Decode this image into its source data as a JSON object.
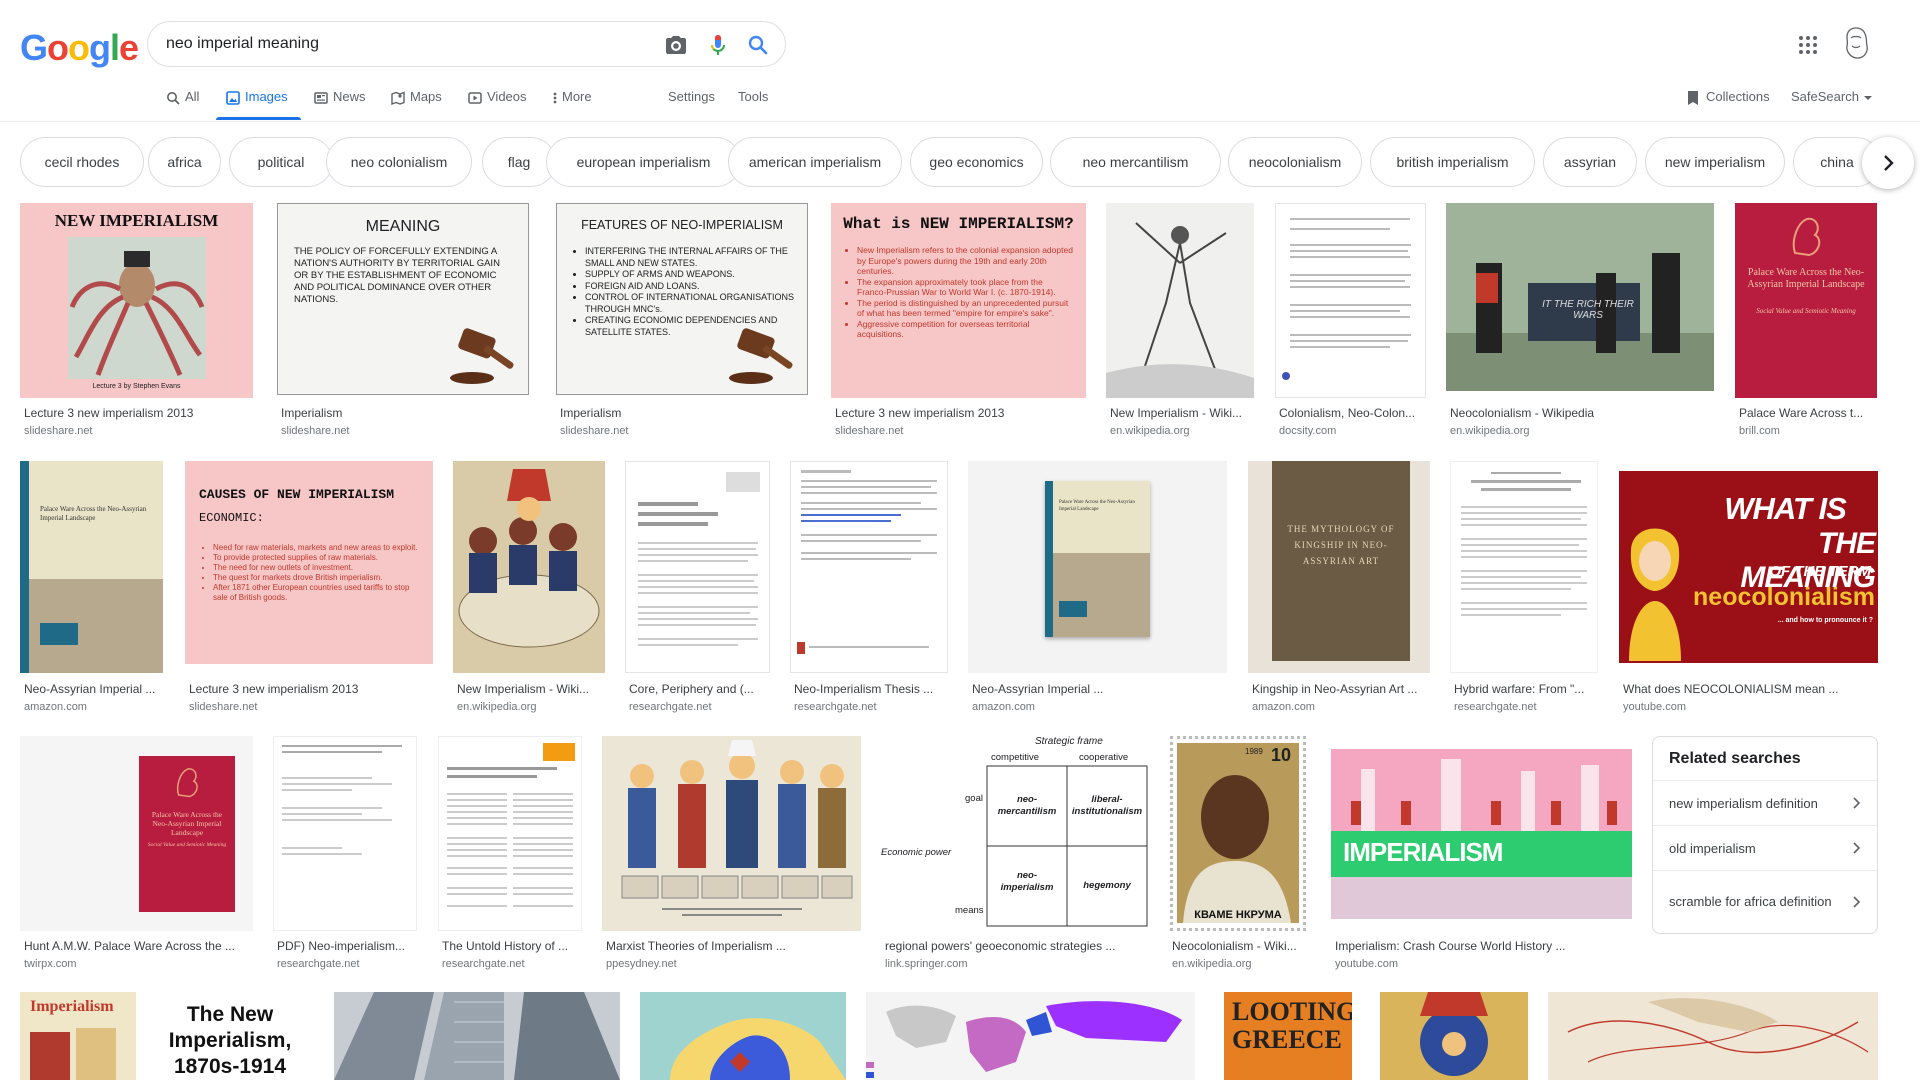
{
  "logo": {
    "letters": [
      "G",
      "o",
      "o",
      "g",
      "l",
      "e"
    ],
    "colors": [
      "#4285F4",
      "#EA4335",
      "#FBBC05",
      "#4285F4",
      "#34A853",
      "#EA4335"
    ]
  },
  "search": {
    "query": "neo imperial meaning"
  },
  "tabs": [
    {
      "label": "All",
      "icon": "search-icon"
    },
    {
      "label": "Images",
      "icon": "image-icon",
      "active": true
    },
    {
      "label": "News",
      "icon": "news-icon"
    },
    {
      "label": "Maps",
      "icon": "map-icon"
    },
    {
      "label": "Videos",
      "icon": "video-icon"
    },
    {
      "label": "More",
      "icon": "more-icon"
    },
    {
      "label": "Settings"
    },
    {
      "label": "Tools"
    }
  ],
  "right_tools": {
    "collections": "Collections",
    "safesearch": "SafeSearch"
  },
  "chips": [
    "cecil rhodes",
    "africa",
    "political",
    "neo colonialism",
    "flag",
    "european imperialism",
    "american imperialism",
    "geo economics",
    "neo mercantilism",
    "neocolonialism",
    "british imperialism",
    "assyrian",
    "new imperialism",
    "china",
    "imperialism"
  ],
  "slides": {
    "s1": {
      "title": "NEW IMPERIALISM",
      "caption": "Lecture 3 by Stephen Evans"
    },
    "s2": {
      "title": "MEANING",
      "body": "THE POLICY OF FORCEFULLY EXTENDING A NATION'S AUTHORITY BY TERRITORIAL GAIN OR BY THE ESTABLISHMENT OF ECONOMIC AND POLITICAL DOMINANCE OVER OTHER NATIONS."
    },
    "s3": {
      "title": "FEATURES OF NEO-IMPERIALISM",
      "items": [
        "INTERFERING THE INTERNAL AFFAIRS OF THE SMALL AND NEW STATES.",
        "SUPPLY OF ARMS AND WEAPONS.",
        "FOREIGN AID AND LOANS.",
        "CONTROL OF INTERNATIONAL ORGANISATIONS THROUGH MNC's.",
        "CREATING ECONOMIC DEPENDENCIES AND SATELLITE STATES."
      ]
    },
    "s4": {
      "title": "What is NEW IMPERIALISM?",
      "items": [
        "New Imperialism refers to the colonial expansion adopted by Europe's powers during the 19th and early 20th centuries.",
        "The expansion approximately took place from the Franco-Prussian War to World War I. (c. 1870-1914).",
        "The period is distinguished by an unprecedented pursuit of what has been termed \"empire for empire's sake\".",
        "Aggressive competition for overseas territorial acquisitions."
      ]
    },
    "s5": {
      "title": "CAUSES OF NEW IMPERIALISM",
      "sub": "ECONOMIC:",
      "items": [
        "Need for raw materials, markets and new areas to exploit.",
        "To provide protected supplies of raw materials.",
        "The need for new outlets of investment.",
        "The quest for markets drove British imperialism.",
        "After 1871 other European countries used tariffs to stop sale of British goods."
      ]
    },
    "book": {
      "title": "Palace Ware Across the Neo-Assyrian Imperial Landscape",
      "subtitle": "Social Value and Semiotic Meaning"
    },
    "kingship": "THE MYTHOLOGY OF KINGSHIP IN NEO-ASSYRIAN ART",
    "video": {
      "l1": "WHAT IS",
      "l2": "THE MEANING",
      "l3": "OF THE TERM",
      "l4": "neocolonialism",
      "l5": "... and how to pronounce it ?"
    },
    "protest": "IT THE RICH THEIR WARS",
    "imperialism": "IMPERIALISM",
    "grid": {
      "frame": "Strategic frame",
      "col1": "competitive",
      "col2": "cooperative",
      "goal": "goal",
      "means": "means",
      "ep": "Economic power",
      "c11": "neo-mercantilism",
      "c12": "liberal-institutionalism",
      "c21": "neo-imperialism",
      "c22": "hegemony"
    },
    "stamp": {
      "value": "10",
      "year": "1989",
      "name": "КВАМЕ НКРУМА"
    },
    "bottom1": {
      "a": "Imperialism",
      "b": "The New Imperialism, 1870s-1914"
    },
    "looting": "LOOTING GREECE"
  },
  "results": [
    {
      "title": "Lecture 3 new imperialism 2013",
      "source": "slideshare.net"
    },
    {
      "title": "Imperialism",
      "source": "slideshare.net"
    },
    {
      "title": "Imperialism",
      "source": "slideshare.net"
    },
    {
      "title": "Lecture 3 new imperialism 2013",
      "source": "slideshare.net"
    },
    {
      "title": "New Imperialism - Wiki...",
      "source": "en.wikipedia.org"
    },
    {
      "title": "Colonialism, Neo-Colon...",
      "source": "docsity.com"
    },
    {
      "title": "Neocolonialism - Wikipedia",
      "source": "en.wikipedia.org"
    },
    {
      "title": "Palace Ware Across t...",
      "source": "brill.com"
    },
    {
      "title": "Neo-Assyrian Imperial ...",
      "source": "amazon.com"
    },
    {
      "title": "Lecture 3 new imperialism 2013",
      "source": "slideshare.net"
    },
    {
      "title": "New Imperialism - Wiki...",
      "source": "en.wikipedia.org"
    },
    {
      "title": "Core, Periphery and (...",
      "source": "researchgate.net"
    },
    {
      "title": "Neo-Imperialism Thesis ...",
      "source": "researchgate.net"
    },
    {
      "title": "Neo-Assyrian Imperial ...",
      "source": "amazon.com"
    },
    {
      "title": "Kingship in Neo-Assyrian Art ...",
      "source": "amazon.com"
    },
    {
      "title": "Hybrid warfare: From \"...",
      "source": "researchgate.net"
    },
    {
      "title": "What does NEOCOLONIALISM mean ...",
      "source": "youtube.com"
    },
    {
      "title": "Hunt A.M.W. Palace Ware Across the ...",
      "source": "twirpx.com"
    },
    {
      "title": "PDF) Neo-imperialism...",
      "source": "researchgate.net"
    },
    {
      "title": "The Untold History of ...",
      "source": "researchgate.net"
    },
    {
      "title": "Marxist Theories of Imperialism ...",
      "source": "ppesydney.net"
    },
    {
      "title": "regional powers' geoeconomic strategies ...",
      "source": "link.springer.com"
    },
    {
      "title": "Neocolonialism - Wiki...",
      "source": "en.wikipedia.org"
    },
    {
      "title": "Imperialism: Crash Course World History ...",
      "source": "youtube.com"
    }
  ],
  "related": {
    "heading": "Related searches",
    "items": [
      "new imperialism definition",
      "old imperialism",
      "scramble for africa definition"
    ]
  }
}
